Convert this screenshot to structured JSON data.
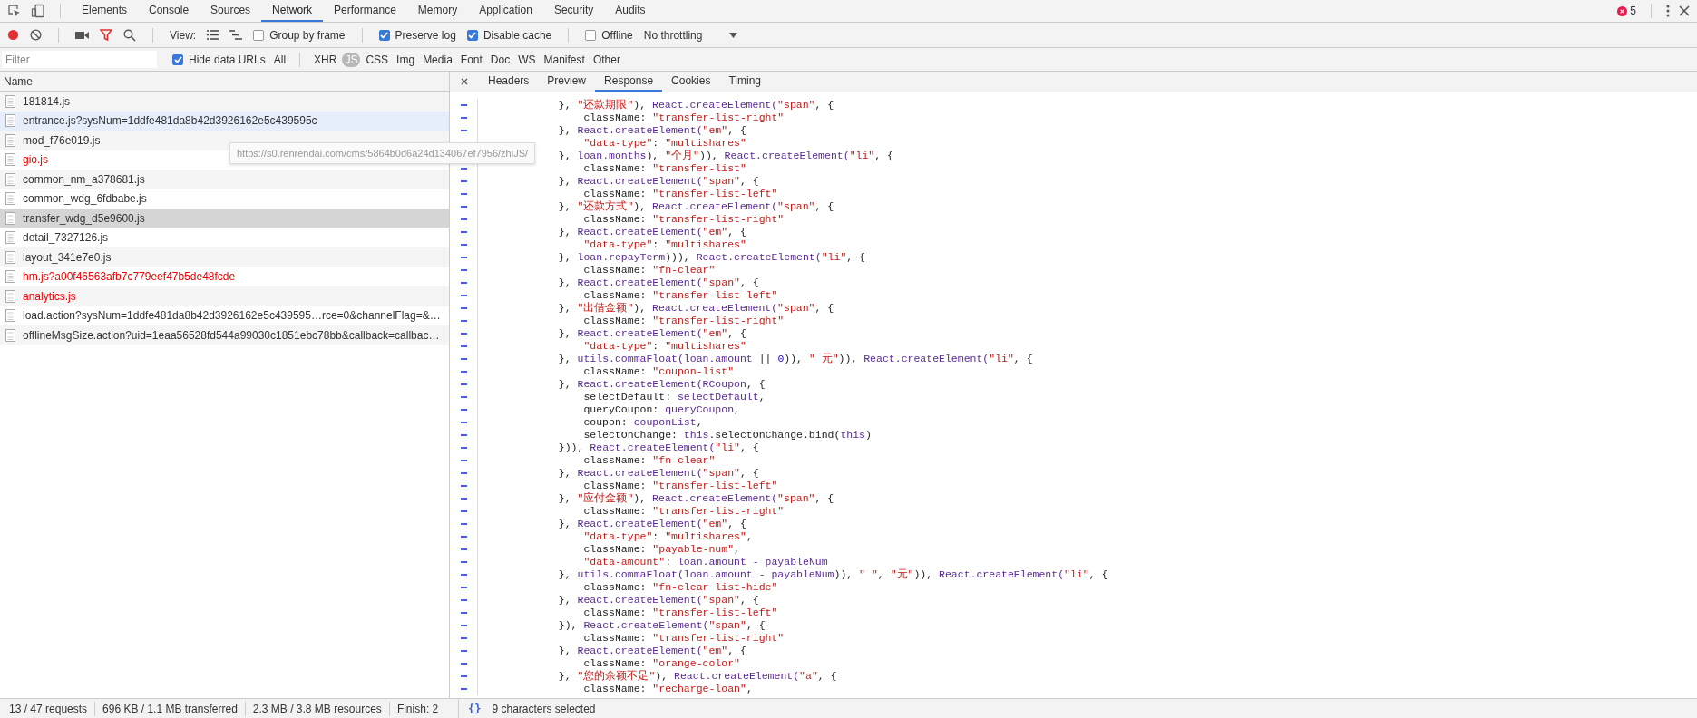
{
  "main_tabs": [
    {
      "label": "Elements",
      "selected": false
    },
    {
      "label": "Console",
      "selected": false
    },
    {
      "label": "Sources",
      "selected": false
    },
    {
      "label": "Network",
      "selected": true
    },
    {
      "label": "Performance",
      "selected": false
    },
    {
      "label": "Memory",
      "selected": false
    },
    {
      "label": "Application",
      "selected": false
    },
    {
      "label": "Security",
      "selected": false
    },
    {
      "label": "Audits",
      "selected": false
    }
  ],
  "error_count": "5",
  "toolbar": {
    "recording": true,
    "filter_active": true,
    "view_label": "View:",
    "options": [
      {
        "label": "Group by frame",
        "checked": false
      },
      {
        "label": "Preserve log",
        "checked": true
      },
      {
        "label": "Disable cache",
        "checked": true
      },
      {
        "label": "Offline",
        "checked": false
      }
    ],
    "throttling": "No throttling"
  },
  "filter_bar": {
    "placeholder": "Filter",
    "hide_data_urls": {
      "label": "Hide data URLs",
      "checked": true
    },
    "types": [
      {
        "label": "All",
        "selected": false
      },
      {
        "label": "XHR",
        "selected": false
      },
      {
        "label": "JS",
        "selected": true
      },
      {
        "label": "CSS",
        "selected": false
      },
      {
        "label": "Img",
        "selected": false
      },
      {
        "label": "Media",
        "selected": false
      },
      {
        "label": "Font",
        "selected": false
      },
      {
        "label": "Doc",
        "selected": false
      },
      {
        "label": "WS",
        "selected": false
      },
      {
        "label": "Manifest",
        "selected": false
      },
      {
        "label": "Other",
        "selected": false
      }
    ]
  },
  "requests": {
    "column": "Name",
    "rows": [
      {
        "name": "181814.js",
        "failed": false,
        "selected": false,
        "hovered": false
      },
      {
        "name": "entrance.js?sysNum=1ddfe481da8b42d3926162e5c439595c",
        "failed": false,
        "selected": false,
        "hovered": true
      },
      {
        "name": "mod_f76e019.js",
        "failed": false,
        "selected": false,
        "hovered": false
      },
      {
        "name": "gio.js",
        "failed": true,
        "selected": false,
        "hovered": false
      },
      {
        "name": "common_nm_a378681.js",
        "failed": false,
        "selected": false,
        "hovered": false
      },
      {
        "name": "common_wdg_6fdbabe.js",
        "failed": false,
        "selected": false,
        "hovered": false
      },
      {
        "name": "transfer_wdg_d5e9600.js",
        "failed": false,
        "selected": true,
        "hovered": false
      },
      {
        "name": "detail_7327126.js",
        "failed": false,
        "selected": false,
        "hovered": false
      },
      {
        "name": "layout_341e7e0.js",
        "failed": false,
        "selected": false,
        "hovered": false
      },
      {
        "name": "hm.js?a00f46563afb7c779eef47b5de48fcde",
        "failed": true,
        "selected": false,
        "hovered": false
      },
      {
        "name": "analytics.js",
        "failed": true,
        "selected": false,
        "hovered": false
      },
      {
        "name": "load.action?sysNum=1ddfe481da8b42d3926162e5c439595…rce=0&channelFlag=&…",
        "failed": false,
        "selected": false,
        "hovered": false
      },
      {
        "name": "offlineMsgSize.action?uid=1eaa56528fd544a99030c1851ebc78bb&callback=callbac…",
        "failed": false,
        "selected": false,
        "hovered": false
      }
    ]
  },
  "tooltip": "https://s0.renrendai.com/cms/5864b0d6a24d134067ef7956/zhiJS/",
  "detail_tabs": [
    {
      "label": "Headers",
      "selected": false
    },
    {
      "label": "Preview",
      "selected": false
    },
    {
      "label": "Response",
      "selected": true
    },
    {
      "label": "Cookies",
      "selected": false
    },
    {
      "label": "Timing",
      "selected": false
    }
  ],
  "code_lines": [
    [
      {
        "kind": "plain",
        "text": "            }, "
      },
      {
        "kind": "string",
        "text": "\"还款期限\""
      },
      {
        "kind": "plain",
        "text": "), "
      },
      {
        "kind": "ref",
        "text": "React.createElement("
      },
      {
        "kind": "string",
        "text": "\"span\""
      },
      {
        "kind": "plain",
        "text": ", {"
      }
    ],
    [
      {
        "kind": "plain",
        "text": "                className: "
      },
      {
        "kind": "string",
        "text": "\"transfer-list-right\""
      }
    ],
    [
      {
        "kind": "plain",
        "text": "            }, "
      },
      {
        "kind": "ref",
        "text": "React.createElement("
      },
      {
        "kind": "string",
        "text": "\"em\""
      },
      {
        "kind": "plain",
        "text": ", {"
      }
    ],
    [
      {
        "kind": "string",
        "text": "                \"data-type\""
      },
      {
        "kind": "plain",
        "text": ": "
      },
      {
        "kind": "string",
        "text": "\"multishares\""
      }
    ],
    [
      {
        "kind": "plain",
        "text": "            }, "
      },
      {
        "kind": "ref",
        "text": "loan.months"
      },
      {
        "kind": "plain",
        "text": "), "
      },
      {
        "kind": "string",
        "text": "\"个月\""
      },
      {
        "kind": "plain",
        "text": ")), "
      },
      {
        "kind": "ref",
        "text": "React.createElement("
      },
      {
        "kind": "string",
        "text": "\"li\""
      },
      {
        "kind": "plain",
        "text": ", {"
      }
    ],
    [
      {
        "kind": "plain",
        "text": "                className: "
      },
      {
        "kind": "string",
        "text": "\"transfer-list\""
      }
    ],
    [
      {
        "kind": "plain",
        "text": "            }, "
      },
      {
        "kind": "ref",
        "text": "React.createElement("
      },
      {
        "kind": "string",
        "text": "\"span\""
      },
      {
        "kind": "plain",
        "text": ", {"
      }
    ],
    [
      {
        "kind": "plain",
        "text": "                className: "
      },
      {
        "kind": "string",
        "text": "\"transfer-list-left\""
      }
    ],
    [
      {
        "kind": "plain",
        "text": "            }, "
      },
      {
        "kind": "string",
        "text": "\"还款方式\""
      },
      {
        "kind": "plain",
        "text": "), "
      },
      {
        "kind": "ref",
        "text": "React.createElement("
      },
      {
        "kind": "string",
        "text": "\"span\""
      },
      {
        "kind": "plain",
        "text": ", {"
      }
    ],
    [
      {
        "kind": "plain",
        "text": "                className: "
      },
      {
        "kind": "string",
        "text": "\"transfer-list-right\""
      }
    ],
    [
      {
        "kind": "plain",
        "text": "            }, "
      },
      {
        "kind": "ref",
        "text": "React.createElement("
      },
      {
        "kind": "string",
        "text": "\"em\""
      },
      {
        "kind": "plain",
        "text": ", {"
      }
    ],
    [
      {
        "kind": "string",
        "text": "                \"data-type\""
      },
      {
        "kind": "plain",
        "text": ": "
      },
      {
        "kind": "string",
        "text": "\"multishares\""
      }
    ],
    [
      {
        "kind": "plain",
        "text": "            }, "
      },
      {
        "kind": "ref",
        "text": "loan.repayTerm"
      },
      {
        "kind": "plain",
        "text": "))), "
      },
      {
        "kind": "ref",
        "text": "React.createElement("
      },
      {
        "kind": "string",
        "text": "\"li\""
      },
      {
        "kind": "plain",
        "text": ", {"
      }
    ],
    [
      {
        "kind": "plain",
        "text": "                className: "
      },
      {
        "kind": "string",
        "text": "\"fn-clear\""
      }
    ],
    [
      {
        "kind": "plain",
        "text": "            }, "
      },
      {
        "kind": "ref",
        "text": "React.createElement("
      },
      {
        "kind": "string",
        "text": "\"span\""
      },
      {
        "kind": "plain",
        "text": ", {"
      }
    ],
    [
      {
        "kind": "plain",
        "text": "                className: "
      },
      {
        "kind": "string",
        "text": "\"transfer-list-left\""
      }
    ],
    [
      {
        "kind": "plain",
        "text": "            }, "
      },
      {
        "kind": "string",
        "text": "\"出借金额\""
      },
      {
        "kind": "plain",
        "text": "), "
      },
      {
        "kind": "ref",
        "text": "React.createElement("
      },
      {
        "kind": "string",
        "text": "\"span\""
      },
      {
        "kind": "plain",
        "text": ", {"
      }
    ],
    [
      {
        "kind": "plain",
        "text": "                className: "
      },
      {
        "kind": "string",
        "text": "\"transfer-list-right\""
      }
    ],
    [
      {
        "kind": "plain",
        "text": "            }, "
      },
      {
        "kind": "ref",
        "text": "React.createElement("
      },
      {
        "kind": "string",
        "text": "\"em\""
      },
      {
        "kind": "plain",
        "text": ", {"
      }
    ],
    [
      {
        "kind": "string",
        "text": "                \"data-type\""
      },
      {
        "kind": "plain",
        "text": ": "
      },
      {
        "kind": "string",
        "text": "\"multishares\""
      }
    ],
    [
      {
        "kind": "plain",
        "text": "            }, "
      },
      {
        "kind": "ref",
        "text": "utils.commaFloat(loan.amount"
      },
      {
        "kind": "plain",
        "text": " || "
      },
      {
        "kind": "number",
        "text": "0"
      },
      {
        "kind": "plain",
        "text": ")), "
      },
      {
        "kind": "string",
        "text": "\" 元\""
      },
      {
        "kind": "plain",
        "text": ")), "
      },
      {
        "kind": "ref",
        "text": "React.createElement("
      },
      {
        "kind": "string",
        "text": "\"li\""
      },
      {
        "kind": "plain",
        "text": ", {"
      }
    ],
    [
      {
        "kind": "plain",
        "text": "                className: "
      },
      {
        "kind": "string",
        "text": "\"coupon-list\""
      }
    ],
    [
      {
        "kind": "plain",
        "text": "            }, "
      },
      {
        "kind": "ref",
        "text": "React.createElement(RCoupon"
      },
      {
        "kind": "plain",
        "text": ", {"
      }
    ],
    [
      {
        "kind": "plain",
        "text": "                selectDefault: "
      },
      {
        "kind": "ref",
        "text": "selectDefault"
      },
      {
        "kind": "plain",
        "text": ","
      }
    ],
    [
      {
        "kind": "plain",
        "text": "                queryCoupon: "
      },
      {
        "kind": "ref",
        "text": "queryCoupon"
      },
      {
        "kind": "plain",
        "text": ","
      }
    ],
    [
      {
        "kind": "plain",
        "text": "                coupon: "
      },
      {
        "kind": "ref",
        "text": "couponList"
      },
      {
        "kind": "plain",
        "text": ","
      }
    ],
    [
      {
        "kind": "plain",
        "text": "                selectOnChange: "
      },
      {
        "kind": "ref",
        "text": "this"
      },
      {
        "kind": "plain",
        "text": ".selectOnChange.bind("
      },
      {
        "kind": "ref",
        "text": "this"
      },
      {
        "kind": "plain",
        "text": ")"
      }
    ],
    [
      {
        "kind": "plain",
        "text": "            })), "
      },
      {
        "kind": "ref",
        "text": "React.createElement("
      },
      {
        "kind": "string",
        "text": "\"li\""
      },
      {
        "kind": "plain",
        "text": ", {"
      }
    ],
    [
      {
        "kind": "plain",
        "text": "                className: "
      },
      {
        "kind": "string",
        "text": "\"fn-clear\""
      }
    ],
    [
      {
        "kind": "plain",
        "text": "            }, "
      },
      {
        "kind": "ref",
        "text": "React.createElement("
      },
      {
        "kind": "string",
        "text": "\"span\""
      },
      {
        "kind": "plain",
        "text": ", {"
      }
    ],
    [
      {
        "kind": "plain",
        "text": "                className: "
      },
      {
        "kind": "string",
        "text": "\"transfer-list-left\""
      }
    ],
    [
      {
        "kind": "plain",
        "text": "            }, "
      },
      {
        "kind": "string",
        "text": "\"应付金额\""
      },
      {
        "kind": "plain",
        "text": "), "
      },
      {
        "kind": "ref",
        "text": "React.createElement("
      },
      {
        "kind": "string",
        "text": "\"span\""
      },
      {
        "kind": "plain",
        "text": ", {"
      }
    ],
    [
      {
        "kind": "plain",
        "text": "                className: "
      },
      {
        "kind": "string",
        "text": "\"transfer-list-right\""
      }
    ],
    [
      {
        "kind": "plain",
        "text": "            }, "
      },
      {
        "kind": "ref",
        "text": "React.createElement("
      },
      {
        "kind": "string",
        "text": "\"em\""
      },
      {
        "kind": "plain",
        "text": ", {"
      }
    ],
    [
      {
        "kind": "string",
        "text": "                \"data-type\""
      },
      {
        "kind": "plain",
        "text": ": "
      },
      {
        "kind": "string",
        "text": "\"multishares\""
      },
      {
        "kind": "plain",
        "text": ","
      }
    ],
    [
      {
        "kind": "plain",
        "text": "                className: "
      },
      {
        "kind": "string",
        "text": "\"payable-num\""
      },
      {
        "kind": "plain",
        "text": ","
      }
    ],
    [
      {
        "kind": "string",
        "text": "                \"data-amount\""
      },
      {
        "kind": "plain",
        "text": ": "
      },
      {
        "kind": "ref",
        "text": "loan.amount - payableNum"
      }
    ],
    [
      {
        "kind": "plain",
        "text": "            }, "
      },
      {
        "kind": "ref",
        "text": "utils.commaFloat(loan.amount - payableNum"
      },
      {
        "kind": "plain",
        "text": ")), "
      },
      {
        "kind": "string",
        "text": "\" \""
      },
      {
        "kind": "plain",
        "text": ", "
      },
      {
        "kind": "string",
        "text": "\"元\""
      },
      {
        "kind": "plain",
        "text": ")), "
      },
      {
        "kind": "ref",
        "text": "React.createElement("
      },
      {
        "kind": "string",
        "text": "\"li\""
      },
      {
        "kind": "plain",
        "text": ", {"
      }
    ],
    [
      {
        "kind": "plain",
        "text": "                className: "
      },
      {
        "kind": "string",
        "text": "\"fn-clear list-hide\""
      }
    ],
    [
      {
        "kind": "plain",
        "text": "            }, "
      },
      {
        "kind": "ref",
        "text": "React.createElement("
      },
      {
        "kind": "string",
        "text": "\"span\""
      },
      {
        "kind": "plain",
        "text": ", {"
      }
    ],
    [
      {
        "kind": "plain",
        "text": "                className: "
      },
      {
        "kind": "string",
        "text": "\"transfer-list-left\""
      }
    ],
    [
      {
        "kind": "plain",
        "text": "            }), "
      },
      {
        "kind": "ref",
        "text": "React.createElement("
      },
      {
        "kind": "string",
        "text": "\"span\""
      },
      {
        "kind": "plain",
        "text": ", {"
      }
    ],
    [
      {
        "kind": "plain",
        "text": "                className: "
      },
      {
        "kind": "string",
        "text": "\"transfer-list-right\""
      }
    ],
    [
      {
        "kind": "plain",
        "text": "            }, "
      },
      {
        "kind": "ref",
        "text": "React.createElement("
      },
      {
        "kind": "string",
        "text": "\"em\""
      },
      {
        "kind": "plain",
        "text": ", {"
      }
    ],
    [
      {
        "kind": "plain",
        "text": "                className: "
      },
      {
        "kind": "string",
        "text": "\"orange-color\""
      }
    ],
    [
      {
        "kind": "plain",
        "text": "            }, "
      },
      {
        "kind": "string",
        "text": "\"您的余额不足\""
      },
      {
        "kind": "plain",
        "text": "), "
      },
      {
        "kind": "ref",
        "text": "React.createElement("
      },
      {
        "kind": "string",
        "text": "\"a\""
      },
      {
        "kind": "plain",
        "text": ", {"
      }
    ],
    [
      {
        "kind": "plain",
        "text": "                className: "
      },
      {
        "kind": "string",
        "text": "\"recharge-loan\""
      },
      {
        "kind": "plain",
        "text": ","
      }
    ]
  ],
  "status": {
    "summary": [
      "13 / 47 requests",
      "696 KB / 1.1 MB transferred",
      "2.3 MB / 3.8 MB resources",
      "Finish: 2"
    ],
    "selection": "9 characters selected",
    "pretty_print": "{}"
  }
}
